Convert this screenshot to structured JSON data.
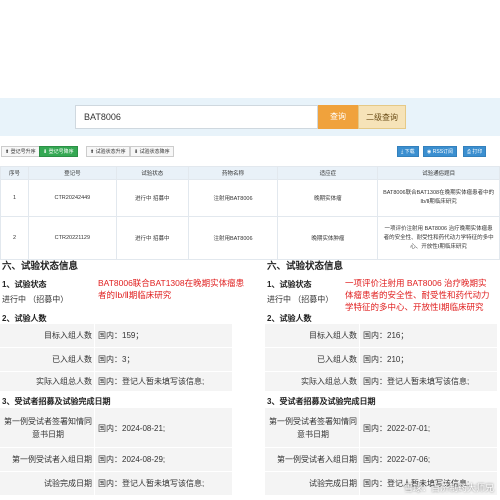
{
  "search": {
    "value": "BAT8006",
    "button": "查询",
    "button2": "二级查询"
  },
  "toolbar": {
    "reg_asc": "登记号升序",
    "reg_desc": "登记号降序",
    "status_asc": "试验状态升序",
    "status_desc": "试验状态降序",
    "download": "下载",
    "rss": "RSS订阅",
    "print": "打印"
  },
  "table": {
    "headers": [
      "序号",
      "登记号",
      "试验状态",
      "药物名称",
      "适应症",
      "试验通俗题目"
    ],
    "rows": [
      [
        "1",
        "CTR20242449",
        "进行中 招募中",
        "注射用BAT8006",
        "晚期实体瘤",
        "BAT8006联合BAT1308在晚期实体瘤患者中的Ⅰb/Ⅱ期临床研究"
      ],
      [
        "2",
        "CTR20221129",
        "进行中 招募中",
        "注射用BAT8006",
        "晚期实体肿瘤",
        "一项评价注射用 BAT8006 治疗晚期实体瘤患者的安全性、耐受性和药代动力学特征的多中心、开放性Ⅰ期临床研究"
      ]
    ]
  },
  "left": {
    "section": "六、试验状态信息",
    "status_title": "1、试验状态",
    "status_value": "进行中 （招募中）",
    "note": "BAT8006联合BAT1308在晚期实体瘤患者的Ⅰb/Ⅱ期临床研究",
    "count_title": "2、试验人数",
    "target_label": "目标入组人数",
    "target_value": "国内：159；",
    "enrolled_label": "已入组人数",
    "enrolled_value": "国内：3；",
    "actual_label": "实际入组总人数",
    "actual_value": "国内：登记人暂未填写该信息;",
    "dates_title": "3、受试者招募及试验完成日期",
    "consent_label": "第一例受试者签署知情同意书日期",
    "consent_value": "国内：2024-08-21;",
    "first_label": "第一例受试者入组日期",
    "first_value": "国内：2024-08-29;",
    "complete_label": "试验完成日期",
    "complete_value": "国内：登记人暂未填写该信息;"
  },
  "right": {
    "section": "六、试验状态信息",
    "status_title": "1、试验状态",
    "status_value": "进行中 （招募中）",
    "note": "一项评价注射用 BAT8006 治疗晚期实体瘤患者的安全性、耐受性和药代动力学特征的多中心、开放性Ⅰ期临床研究",
    "count_title": "2、试验人数",
    "target_label": "目标入组人数",
    "target_value": "国内：216；",
    "enrolled_label": "已入组人数",
    "enrolled_value": "国内：210；",
    "actual_label": "实际入组总人数",
    "actual_value": "国内：登记人暂未填写该信息;",
    "dates_title": "3、受试者招募及试验完成日期",
    "consent_label": "第一例受试者签署知情同意书日期",
    "consent_value": "国内：2022-07-01;",
    "first_label": "第一例受试者入组日期",
    "first_value": "国内：2022-07-06;",
    "complete_label": "试验完成日期",
    "complete_value": "国内：登记人暂未填写该信息;"
  },
  "watermark": "雪球：百济制药大师兄"
}
